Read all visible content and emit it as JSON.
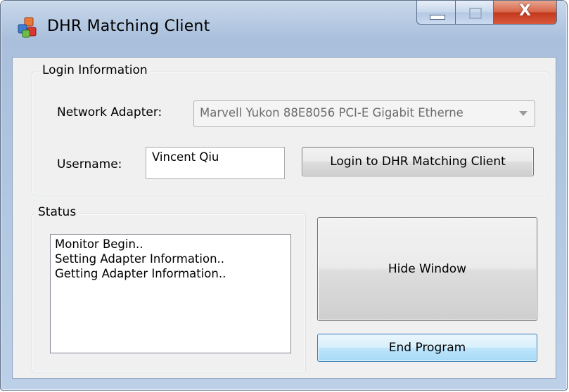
{
  "window": {
    "title": "DHR Matching Client",
    "close_glyph": "X"
  },
  "login": {
    "group_label": "Login Information",
    "adapter_label": "Network Adapter:",
    "adapter_value": "Marvell Yukon 88E8056 PCI-E Gigabit Etherne",
    "username_label": "Username:",
    "username_value": "Vincent Qiu",
    "login_button": "Login to DHR Matching Client"
  },
  "status": {
    "group_label": "Status",
    "lines": [
      "Monitor Begin..",
      "Setting Adapter Information..",
      "Getting Adapter Information.."
    ]
  },
  "actions": {
    "hide_window": "Hide Window",
    "end_program": "End Program"
  },
  "colors": {
    "focus_border": "#3c7fb1",
    "close_button": "#c2391c",
    "window_frame": "#b5c9e2"
  },
  "icons": {
    "app": "app-blocks-icon",
    "minimize": "minimize-icon",
    "maximize": "maximize-icon",
    "close": "close-icon",
    "dropdown": "chevron-down-icon"
  }
}
